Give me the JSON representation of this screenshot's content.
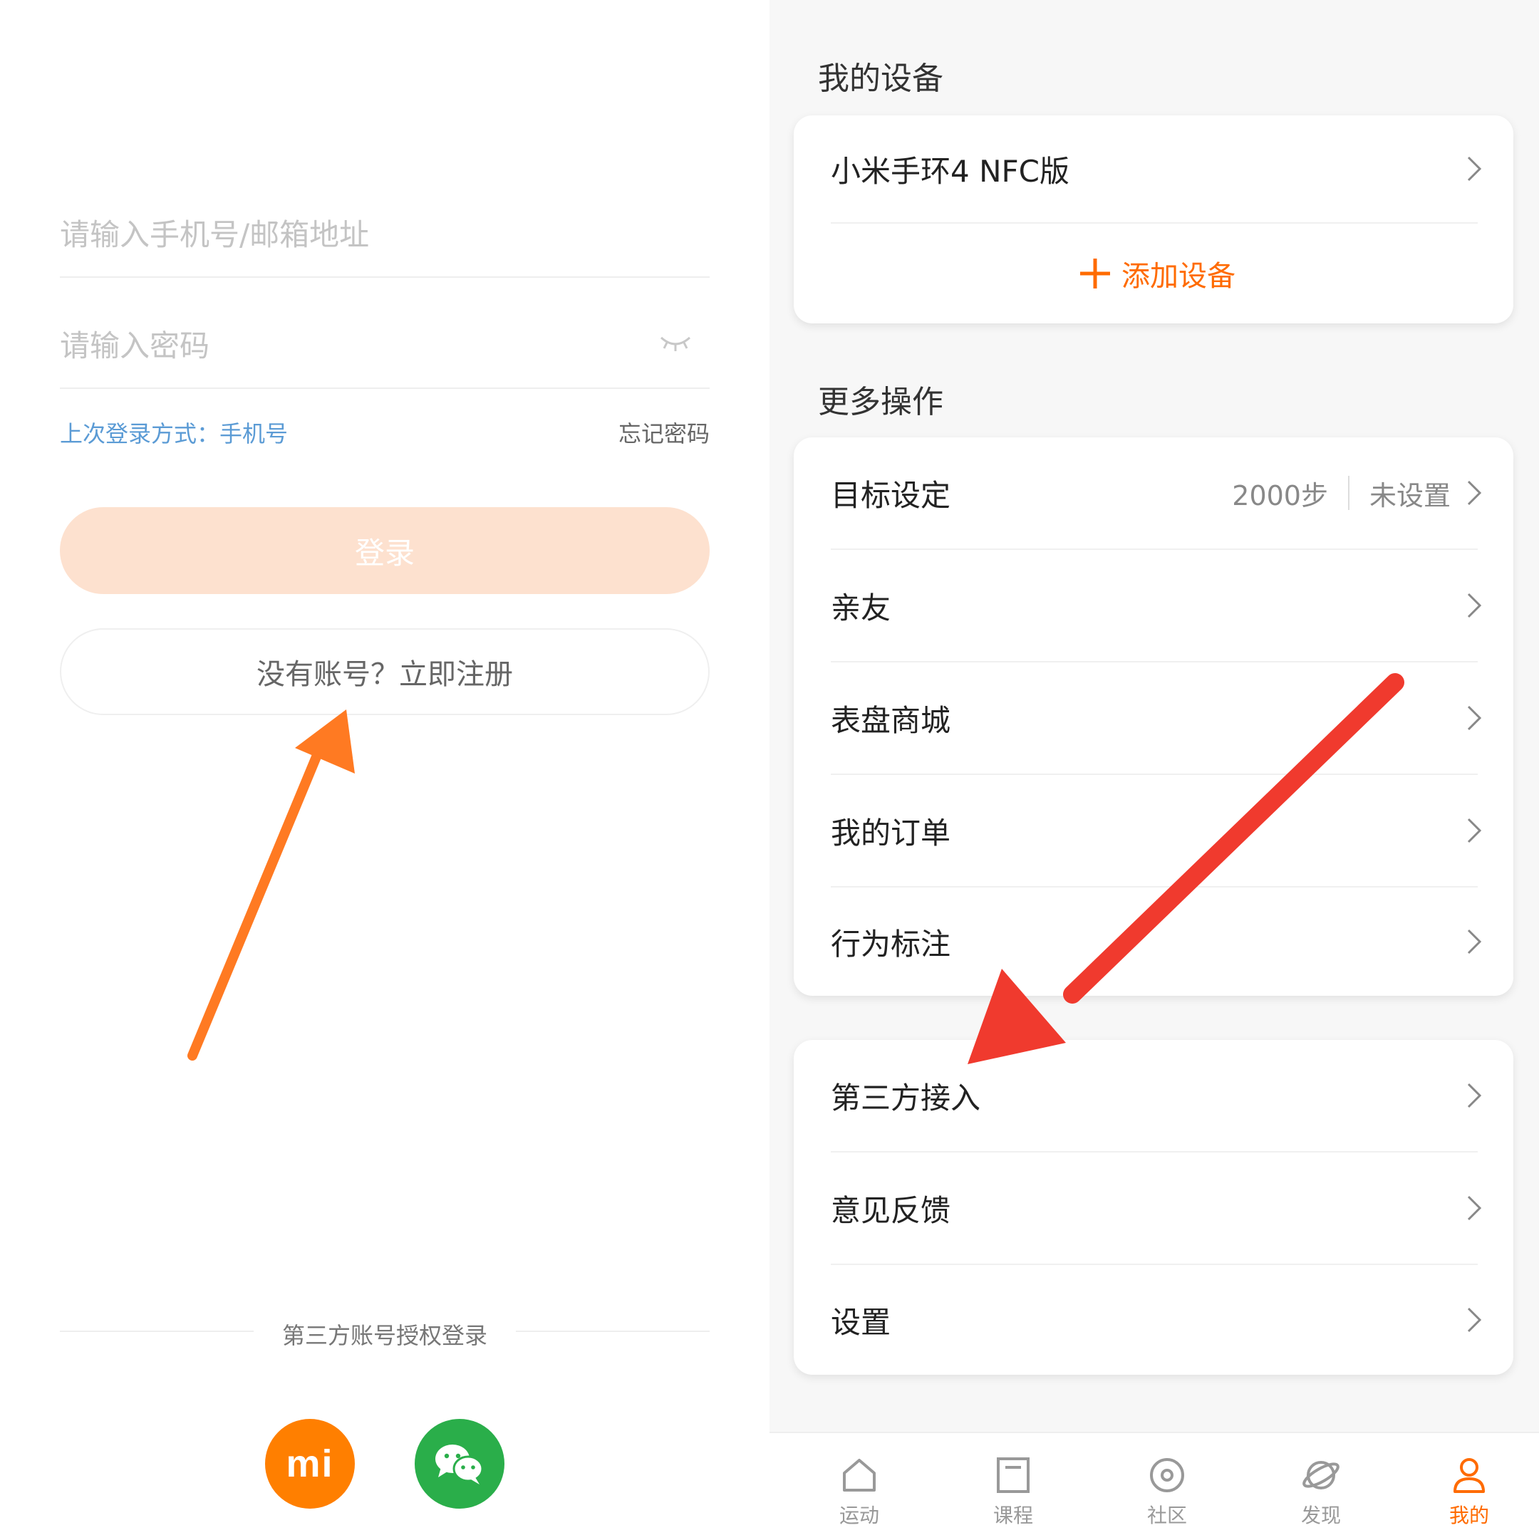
{
  "login": {
    "phone_placeholder": "请输入手机号/邮箱地址",
    "password_placeholder": "请输入密码",
    "last_login": "上次登录方式：手机号",
    "forgot_password": "忘记密码",
    "login_button": "登录",
    "register_button": "没有账号？立即注册",
    "third_party_label": "第三方账号授权登录",
    "mi_logo_text": "mi"
  },
  "devices": {
    "section_title": "我的设备",
    "device_name": "小米手环4 NFC版",
    "add_device": "添加设备"
  },
  "more": {
    "section_title": "更多操作",
    "goal": {
      "label": "目标设定",
      "steps": "2000步",
      "status": "未设置"
    },
    "items": [
      {
        "label": "亲友"
      },
      {
        "label": "表盘商城"
      },
      {
        "label": "我的订单"
      },
      {
        "label": "行为标注"
      }
    ]
  },
  "misc": {
    "items": [
      {
        "label": "第三方接入"
      },
      {
        "label": "意见反馈"
      },
      {
        "label": "设置"
      }
    ]
  },
  "tabs": [
    {
      "label": "运动",
      "icon": "home-icon",
      "active": false
    },
    {
      "label": "课程",
      "icon": "course-icon",
      "active": false
    },
    {
      "label": "社区",
      "icon": "community-icon",
      "active": false
    },
    {
      "label": "发现",
      "icon": "planet-icon",
      "active": false
    },
    {
      "label": "我的",
      "icon": "person-icon",
      "active": true
    }
  ],
  "colors": {
    "accent": "#ff6b00",
    "login_disabled": "#fde1cf",
    "link_blue": "#5b9bd5",
    "wechat_green": "#2aae4a",
    "mi_orange": "#ff7f00",
    "annotation_orange": "#ff7a22",
    "annotation_red": "#f03a2e"
  }
}
